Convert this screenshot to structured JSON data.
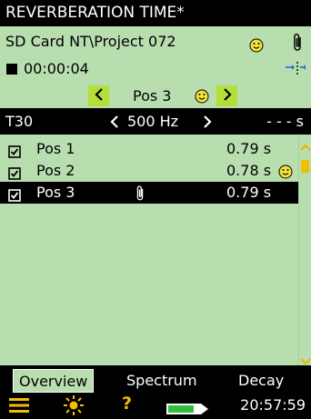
{
  "title": "REVERBERATION TIME*",
  "status": {
    "path": "SD  Card NT\\Project 072",
    "elapsed": "00:00:04"
  },
  "position_nav": {
    "label": "Pos 3"
  },
  "parameter_row": {
    "param": "T30",
    "frequency": "500 Hz",
    "value": "- - - s"
  },
  "list": {
    "rows": [
      {
        "name": "Pos 1",
        "value": "0.79 s",
        "checked": true
      },
      {
        "name": "Pos 2",
        "value": "0.78 s",
        "checked": true
      },
      {
        "name": "Pos 3",
        "value": "0.79 s",
        "checked": true
      }
    ]
  },
  "tabs": [
    "Overview",
    "Spectrum",
    "Decay"
  ],
  "bottom": {
    "time": "20:57:59"
  },
  "colors": {
    "panel": "#b8deb0",
    "accent": "#b5de38",
    "smiley": "#f2e23a"
  }
}
